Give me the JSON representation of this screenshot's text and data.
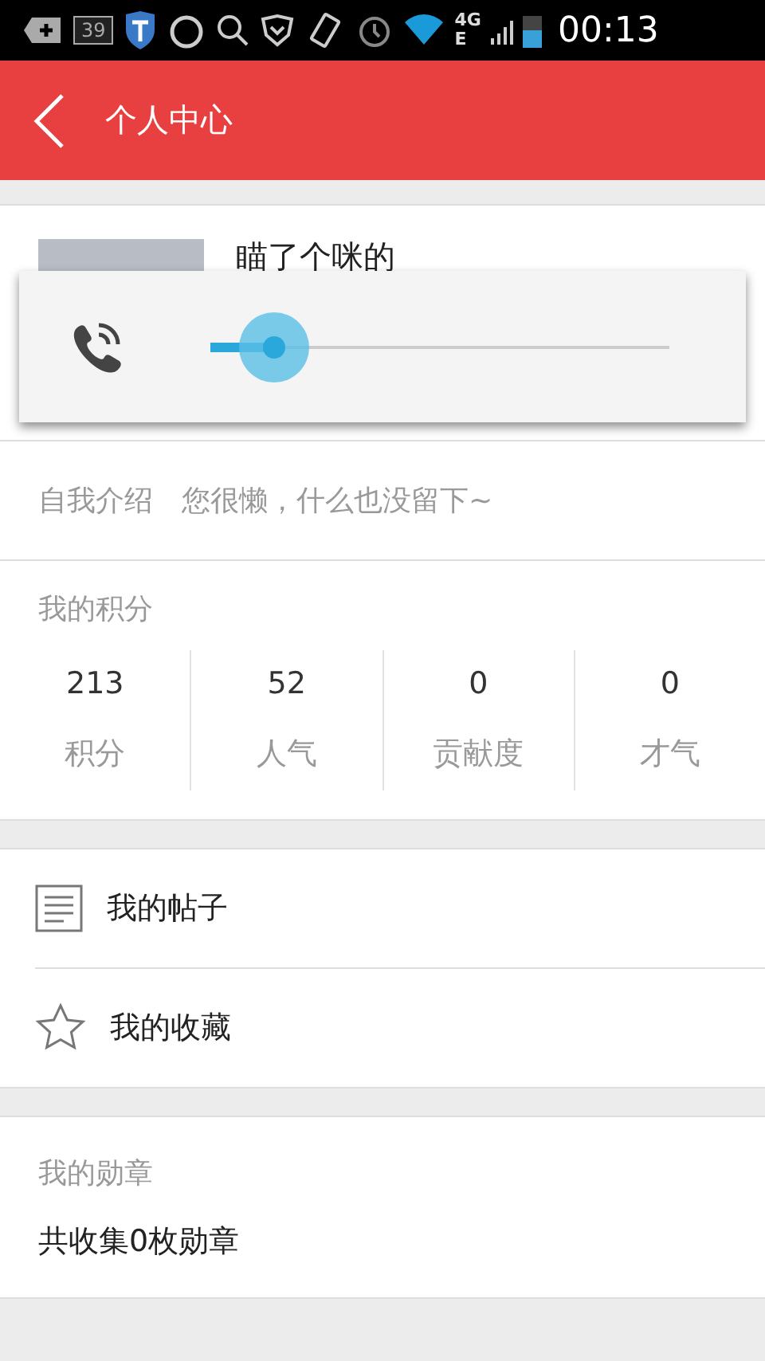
{
  "status_bar": {
    "badge": "39",
    "network_top": "4G",
    "network_bottom": "E",
    "time": "00:13"
  },
  "header": {
    "title": "个人中心"
  },
  "profile": {
    "name": "瞄了个咪的"
  },
  "volume_popup": {
    "level": 0.14
  },
  "intro": {
    "label": "自我介绍",
    "value": "您很懒，什么也没留下~"
  },
  "points": {
    "title": "我的积分",
    "stats": [
      {
        "value": "213",
        "label": "积分"
      },
      {
        "value": "52",
        "label": "人气"
      },
      {
        "value": "0",
        "label": "贡献度"
      },
      {
        "value": "0",
        "label": "才气"
      }
    ]
  },
  "menu": [
    {
      "kind": "posts",
      "label": "我的帖子"
    },
    {
      "kind": "favorites",
      "label": "我的收藏"
    }
  ],
  "medals": {
    "title": "我的勋章",
    "summary": "共收集0枚勋章"
  }
}
